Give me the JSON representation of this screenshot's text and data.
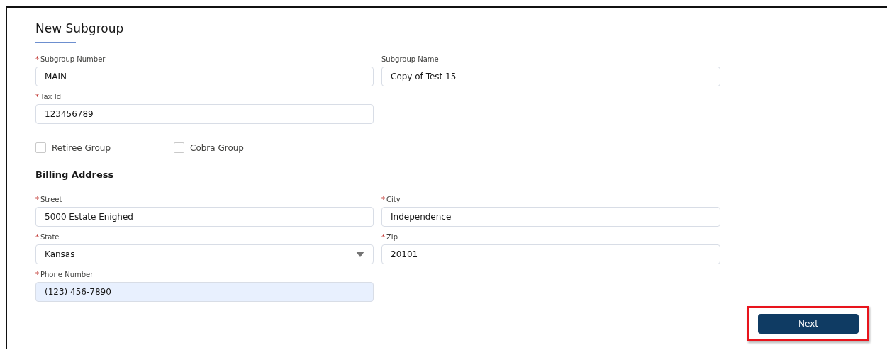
{
  "title": "New Subgroup",
  "top_rows": [
    [
      {
        "required_mark": "*",
        "label": "Subgroup Number",
        "kind": "text",
        "value": "MAIN",
        "autofilled": false
      },
      {
        "label": "Subgroup Name",
        "kind": "text",
        "value": "Copy of Test 15",
        "autofilled": false
      }
    ],
    [
      {
        "required_mark": "*",
        "label": "Tax Id",
        "kind": "text",
        "value": "123456789",
        "autofilled": false
      }
    ]
  ],
  "checkboxes": [
    {
      "label": "Retiree Group",
      "checked": false
    },
    {
      "label": "Cobra Group",
      "checked": false
    }
  ],
  "section_title": "Billing Address",
  "address_rows": [
    [
      {
        "required_mark": "*",
        "label": "Street",
        "kind": "text",
        "value": "5000 Estate Enighed",
        "autofilled": false
      },
      {
        "required_mark": "*",
        "label": "City",
        "kind": "text",
        "value": "Independence",
        "autofilled": false
      }
    ],
    [
      {
        "required_mark": "*",
        "label": "State",
        "kind": "select",
        "value": "Kansas",
        "autofilled": false
      },
      {
        "required_mark": "*",
        "label": "Zip",
        "kind": "text",
        "value": "20101",
        "autofilled": false
      }
    ],
    [
      {
        "required_mark": "*",
        "label": "Phone Number",
        "kind": "text",
        "value": "(123) 456-7890",
        "autofilled": true
      }
    ]
  ],
  "next_button": {
    "label": "Next",
    "highlighted": true
  }
}
